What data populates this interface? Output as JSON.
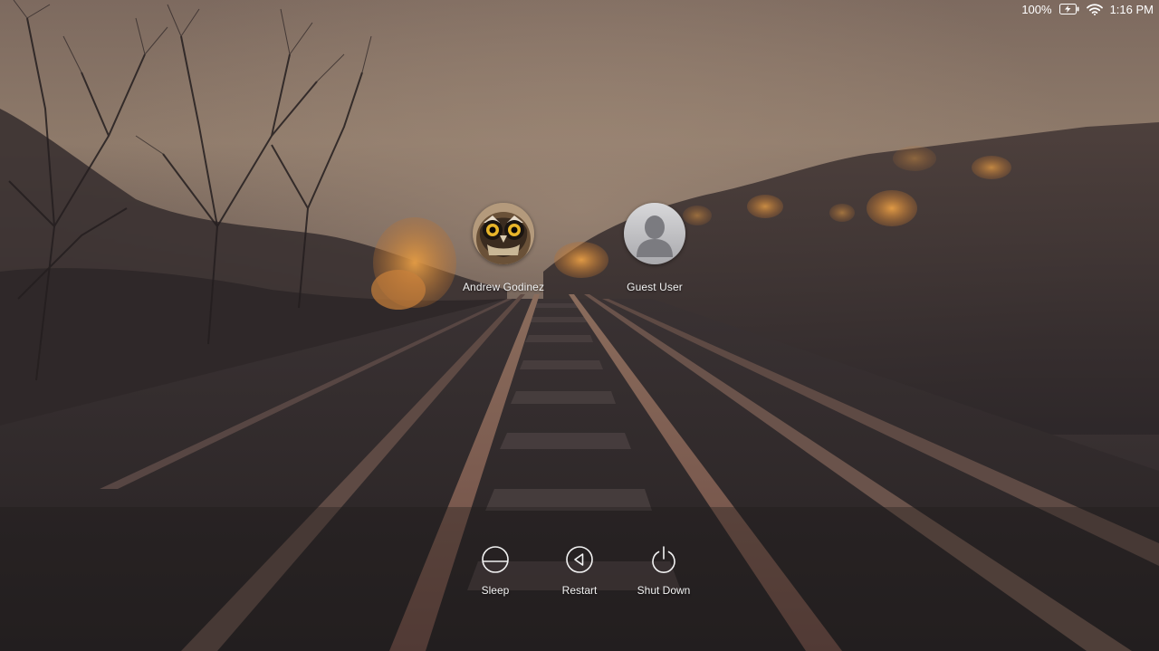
{
  "status_bar": {
    "battery_percent": "100%",
    "battery_icon": "battery-charging-icon",
    "wifi_icon": "wifi-icon",
    "time": "1:16 PM"
  },
  "users": [
    {
      "name": "Andrew Godinez",
      "avatar_icon": "owl-avatar-icon"
    },
    {
      "name": "Guest User",
      "avatar_icon": "generic-user-icon"
    }
  ],
  "power_buttons": [
    {
      "label": "Sleep",
      "icon": "sleep-icon"
    },
    {
      "label": "Restart",
      "icon": "restart-icon"
    },
    {
      "label": "Shut Down",
      "icon": "power-icon"
    }
  ],
  "colors": {
    "sky": "#8a7868",
    "foliage": "#d98a3a",
    "ground": "#2b2627",
    "rail": "#7a5a4c",
    "text": "#f2f2f2"
  }
}
